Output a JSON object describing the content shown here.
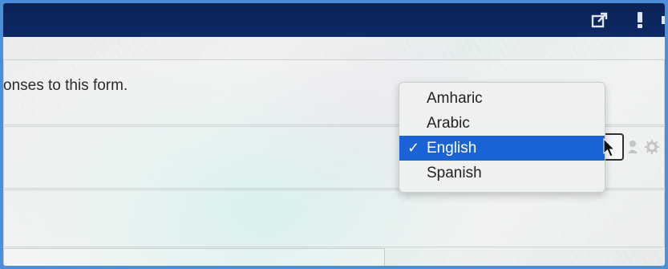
{
  "form": {
    "note_text": "onses to this form."
  },
  "language_dropdown": {
    "options": [
      {
        "label": "Amharic",
        "selected": false
      },
      {
        "label": "Arabic",
        "selected": false
      },
      {
        "label": "English",
        "selected": true
      },
      {
        "label": "Spanish",
        "selected": false
      }
    ],
    "check_glyph": "✓"
  },
  "icons": {
    "topbar": [
      "external-link-icon",
      "alert-icon"
    ],
    "row": [
      "user-icon",
      "gear-icon"
    ]
  },
  "colors": {
    "topbar": "#0d2a66",
    "selection": "#1a63d6",
    "frame_border": "#4a90d9"
  }
}
